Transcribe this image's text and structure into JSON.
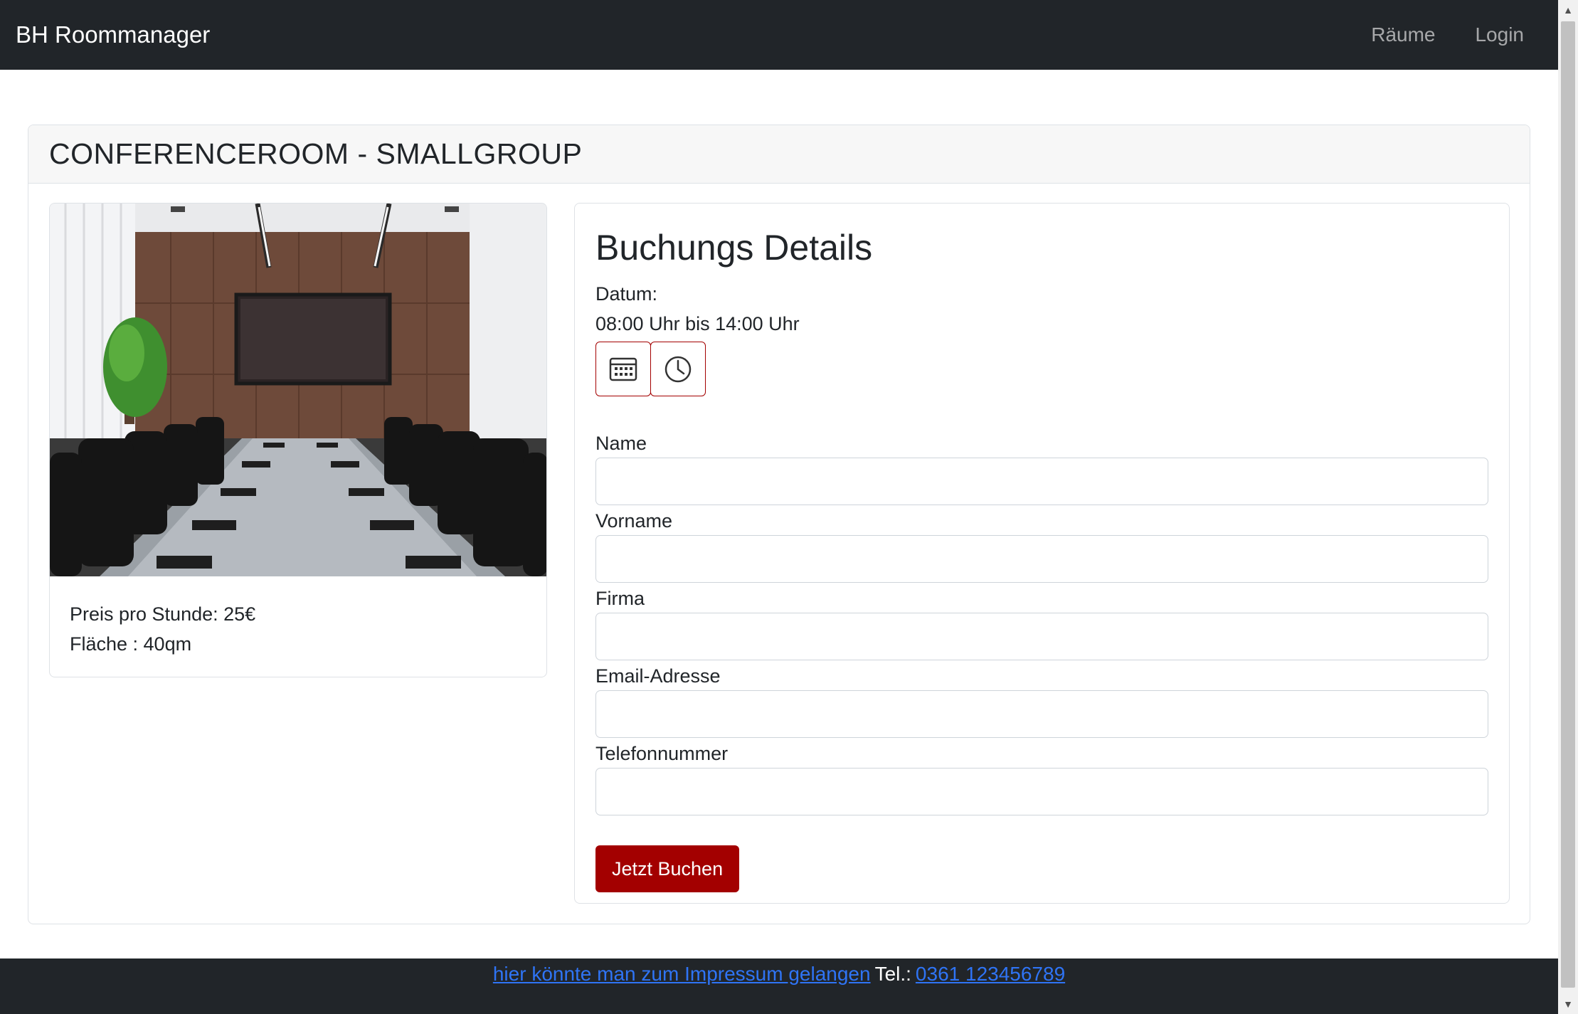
{
  "navbar": {
    "brand": "BH Roommanager",
    "links": [
      "Räume",
      "Login"
    ]
  },
  "room": {
    "title": "CONFERENCEROOM - SMALLGROUP",
    "image_alt": "Conference room",
    "price": "Preis pro Stunde: 25€",
    "area": "Fläche : 40qm"
  },
  "booking": {
    "title": "Buchungs Details",
    "date_label": "Datum:",
    "time_range": "08:00 Uhr bis 14:00 Uhr",
    "icons": [
      "calendar-icon",
      "clock-icon"
    ],
    "fields": [
      {
        "label": "Name",
        "value": ""
      },
      {
        "label": "Vorname",
        "value": ""
      },
      {
        "label": "Firma",
        "value": ""
      },
      {
        "label": "Email-Adresse",
        "value": ""
      },
      {
        "label": "Telefonnummer",
        "value": ""
      }
    ],
    "submit_label": "Jetzt Buchen"
  },
  "footer": {
    "impressum_link": "hier könnte man zum Impressum gelangen",
    "tel_label": "Tel.:",
    "phone": "0361 123456789"
  },
  "colors": {
    "navbar_bg": "#212529",
    "accent": "#a30000",
    "link": "#2f74f5"
  }
}
